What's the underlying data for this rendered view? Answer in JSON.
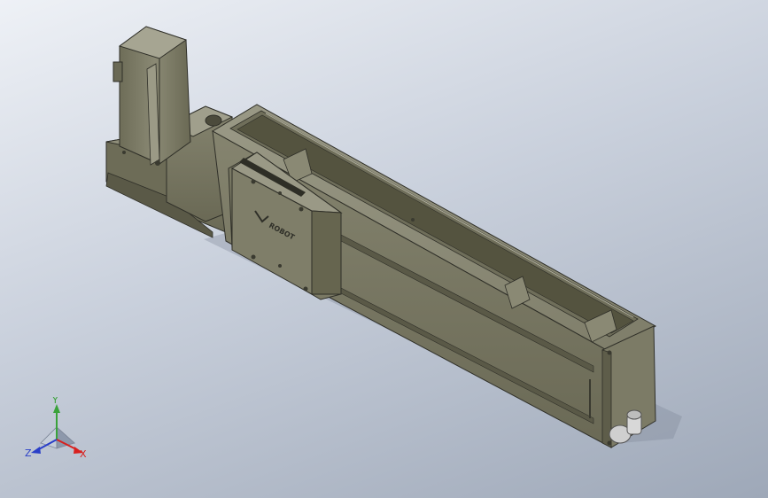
{
  "model": {
    "logo_text": "ROBOT",
    "colors": {
      "body_light": "#8d8c7a",
      "body_mid": "#76755f",
      "body_dark": "#5a5947",
      "edge": "#2f2f28",
      "background_top": "#eef1f6",
      "background_bottom": "#9ea8b8"
    }
  },
  "triad": {
    "x_label": "X",
    "y_label": "Y",
    "z_label": "Z",
    "x_color": "#d8201e",
    "y_color": "#3aa23a",
    "z_color": "#2a3fc8"
  }
}
